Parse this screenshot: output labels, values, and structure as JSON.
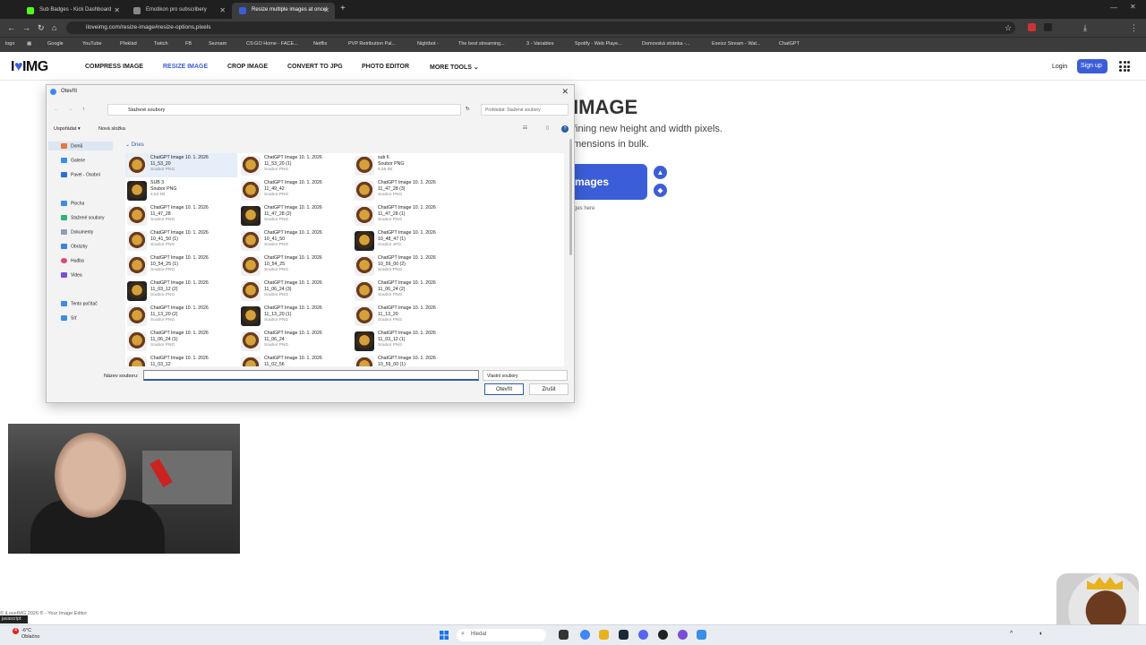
{
  "browser": {
    "tabs": [
      {
        "label": "Sub Badges - Kick Dashboard",
        "active": false,
        "fav_color": "#53fc18"
      },
      {
        "label": "Emotikon pro subscribery",
        "active": false,
        "fav_color": "#888888"
      },
      {
        "label": "Resize multiple images at once!",
        "active": true,
        "fav_color": "#3b5ed8"
      }
    ],
    "url": "iloveimg.com/resize-image#resize-options,pixels",
    "bookmarks": [
      "logo",
      "Google",
      "YouTube",
      "Překlád",
      "Twitch",
      "FB",
      "Seznam",
      "CS:GO Home - FACE...",
      "Netflix",
      "PVP Retribution Pal...",
      "Nightbot -",
      "The best streaming...",
      "3 - Variables",
      "Spotify - Web Playe...",
      "Domovská stránka -...",
      "Exeizz Stream - Wat...",
      "ChatGPT"
    ]
  },
  "site": {
    "logo_prefix": "I",
    "logo_heart": "♥",
    "logo_suffix": "IMG",
    "nav": [
      "COMPRESS IMAGE",
      "RESIZE IMAGE",
      "CROP IMAGE",
      "CONVERT TO JPG",
      "PHOTO EDITOR",
      "MORE TOOLS"
    ],
    "nav_active": "RESIZE IMAGE",
    "login": "Login",
    "signup": "Sign up",
    "hero_title": "IMAGE",
    "hero_line1": "fining new height and width pixels.",
    "hero_line2": "mensions in bulk.",
    "select_button": "mages",
    "drop_note": "ges here",
    "footer": "© iLoveIMG 2026 ® - Your Image Editor",
    "status_badge": "javascript:",
    "accent": "#3b5ed8"
  },
  "dialog": {
    "title": "Otevřít",
    "path": "Stažené soubory",
    "search_placeholder": "Prohledat: Stažené soubory",
    "organize": "Uspořádat ▾",
    "new_folder": "Nová složka",
    "sidebar": [
      "Domů",
      "Galerie",
      "Pavel - Osobní",
      "Plocha",
      "Stažené soubory",
      "Dokumenty",
      "Obrázky",
      "Hudba",
      "Videa",
      "Tento počítač",
      "Síť"
    ],
    "sidebar_selected": "Domů",
    "group_label": "Dnes",
    "files": [
      {
        "name": "ChatGPT Image 10. 1. 2026",
        "name2": "11_53_20",
        "type": "Soubor PNG",
        "selected": true
      },
      {
        "name": "ChatGPT Image 10. 1. 2026",
        "name2": "11_53_20 (1)",
        "type": "Soubor PNG"
      },
      {
        "name": "sub 6",
        "name2": "Soubor PNG",
        "type": "6,55 kB"
      },
      {
        "name": "SUB 3",
        "name2": "Soubor PNG",
        "type": "4,63 kB"
      },
      {
        "name": "ChatGPT Image 10. 1. 2026",
        "name2": "11_49_42",
        "type": "Soubor PNG"
      },
      {
        "name": "ChatGPT Image 10. 1. 2026",
        "name2": "11_47_28 (3)",
        "type": "Soubor PNG"
      },
      {
        "name": "ChatGPT Image 10. 1. 2026",
        "name2": "11_47_28",
        "type": "Soubor PNG"
      },
      {
        "name": "ChatGPT Image 10. 1. 2026",
        "name2": "11_47_28 (2)",
        "type": "Soubor PNG"
      },
      {
        "name": "ChatGPT Image 10. 1. 2026",
        "name2": "11_47_28 (1)",
        "type": "Soubor PNG"
      },
      {
        "name": "ChatGPT Image 10. 1. 2026",
        "name2": "10_41_50 (1)",
        "type": "Soubor PNG"
      },
      {
        "name": "ChatGPT Image 10. 1. 2026",
        "name2": "10_41_50",
        "type": "Soubor PNG"
      },
      {
        "name": "ChatGPT Image 10. 1. 2026",
        "name2": "10_48_47 (1)",
        "type": "Soubor JPG"
      },
      {
        "name": "ChatGPT Image 10. 1. 2026",
        "name2": "10_54_25 (1)",
        "type": "Soubor PNG"
      },
      {
        "name": "ChatGPT Image 10. 1. 2026",
        "name2": "10_54_25",
        "type": "Soubor PNG"
      },
      {
        "name": "ChatGPT Image 10. 1. 2026",
        "name2": "10_59_00 (2)",
        "type": "Soubor PNG"
      },
      {
        "name": "ChatGPT Image 10. 1. 2026",
        "name2": "11_03_12 (2)",
        "type": "Soubor PNG"
      },
      {
        "name": "ChatGPT Image 10. 1. 2026",
        "name2": "11_06_24 (3)",
        "type": "Soubor PNG"
      },
      {
        "name": "ChatGPT Image 10. 1. 2026",
        "name2": "11_06_24 (2)",
        "type": "Soubor PNG"
      },
      {
        "name": "ChatGPT Image 10. 1. 2026",
        "name2": "11_13_20 (2)",
        "type": "Soubor PNG"
      },
      {
        "name": "ChatGPT Image 10. 1. 2026",
        "name2": "11_13_20 (1)",
        "type": "Soubor PNG"
      },
      {
        "name": "ChatGPT Image 10. 1. 2026",
        "name2": "11_13_20",
        "type": "Soubor PNG"
      },
      {
        "name": "ChatGPT Image 10. 1. 2026",
        "name2": "11_06_24 (1)",
        "type": "Soubor PNG"
      },
      {
        "name": "ChatGPT Image 10. 1. 2026",
        "name2": "11_06_24",
        "type": "Soubor PNG"
      },
      {
        "name": "ChatGPT Image 10. 1. 2026",
        "name2": "11_03_12 (1)",
        "type": "Soubor PNG"
      },
      {
        "name": "ChatGPT Image 10. 1. 2026",
        "name2": "11_03_12",
        "type": ""
      },
      {
        "name": "ChatGPT Image 10. 1. 2026",
        "name2": "11_02_56",
        "type": ""
      },
      {
        "name": "ChatGPT Image 10. 1. 2026",
        "name2": "10_59_00 (1)",
        "type": ""
      }
    ],
    "filename_label": "Název souboru:",
    "filename_value": "",
    "filetype": "Vlastní soubory",
    "open": "Otevřít",
    "cancel": "Zrušit"
  },
  "taskbar": {
    "temp": "-6°C",
    "weather": "Oblačno",
    "notif": "4",
    "search": "Hledat"
  }
}
